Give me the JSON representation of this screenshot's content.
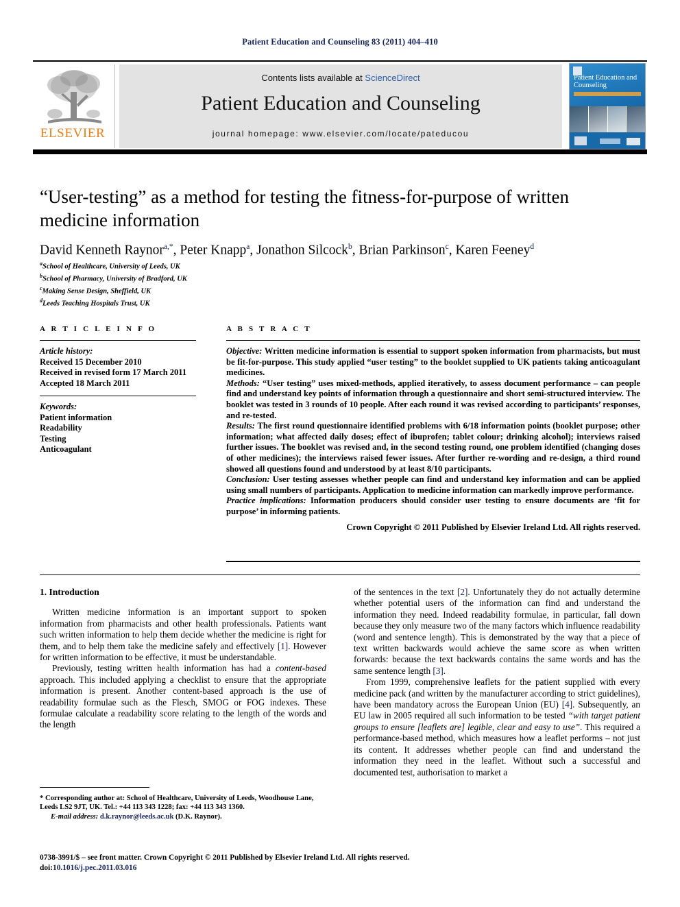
{
  "running_head": "Patient Education and Counseling 83 (2011) 404–410",
  "masthead": {
    "contents_prefix": "Contents lists available at ",
    "sciencedirect": "ScienceDirect",
    "journal_title": "Patient Education and Counseling",
    "homepage": "journal homepage: www.elsevier.com/locate/pateducou",
    "publisher_wordmark": "ELSEVIER",
    "cover_title": "Patient Education and Counseling",
    "accent_blue": "#2b5fa8",
    "accent_orange": "#f07f13",
    "link_navy": "#14215c"
  },
  "article": {
    "title": "“User-testing” as a method for testing the fitness-for-purpose of written medicine information",
    "authors": [
      {
        "name": "David Kenneth Raynor",
        "marks": "a,*"
      },
      {
        "name": "Peter Knapp",
        "marks": "a"
      },
      {
        "name": "Jonathon Silcock",
        "marks": "b"
      },
      {
        "name": "Brian Parkinson",
        "marks": "c"
      },
      {
        "name": "Karen Feeney",
        "marks": "d"
      }
    ],
    "affiliations": [
      {
        "mark": "a",
        "text": "School of Healthcare, University of Leeds, UK"
      },
      {
        "mark": "b",
        "text": "School of Pharmacy, University of Bradford, UK"
      },
      {
        "mark": "c",
        "text": "Making Sense Design, Sheffield, UK"
      },
      {
        "mark": "d",
        "text": "Leeds Teaching Hospitals Trust, UK"
      }
    ]
  },
  "article_info": {
    "heading": "A R T I C L E    I N F O",
    "history_label": "Article history:",
    "history": [
      "Received 15 December 2010",
      "Received in revised form 17 March 2011",
      "Accepted 18 March 2011"
    ],
    "keywords_label": "Keywords:",
    "keywords": [
      "Patient information",
      "Readability",
      "Testing",
      "Anticoagulant"
    ]
  },
  "abstract": {
    "heading": "A B S T R A C T",
    "sections": [
      {
        "label": "Objective:",
        "text": " Written medicine information is essential to support spoken information from pharmacists, but must be fit-for-purpose. This study applied “user testing” to the booklet supplied to UK patients taking anticoagulant medicines."
      },
      {
        "label": "Methods:",
        "text": " “User testing” uses mixed-methods, applied iteratively, to assess document performance – can people find and understand key points of information through a questionnaire and short semi-structured interview. The booklet was tested in 3 rounds of 10 people. After each round it was revised according to participants’ responses, and re-tested."
      },
      {
        "label": "Results:",
        "text": " The first round questionnaire identified problems with 6/18 information points (booklet purpose; other information; what affected daily doses; effect of ibuprofen; tablet colour; drinking alcohol); interviews raised further issues. The booklet was revised and, in the second testing round, one problem identified (changing doses of other medicines); the interviews raised fewer issues. After further re-wording and re-design, a third round showed all questions found and understood by at least 8/10 participants."
      },
      {
        "label": "Conclusion:",
        "text": " User testing assesses whether people can find and understand key information and can be applied using small numbers of participants. Application to medicine information can markedly improve performance."
      },
      {
        "label": "Practice implications:",
        "text": " Information producers should consider user testing to ensure documents are ‘fit for purpose’ in informing patients."
      }
    ],
    "copyright": "Crown Copyright © 2011 Published by Elsevier Ireland Ltd. All rights reserved."
  },
  "body": {
    "section_heading": "1. Introduction",
    "left_paragraphs": [
      {
        "parts": [
          {
            "t": "Written medicine information is an important support to spoken information from pharmacists and other health professionals. Patients want such written information to help them decide whether the medicine is right for them, and to help them take the medicine safely and effectively "
          },
          {
            "t": "[1]",
            "style": "cite"
          },
          {
            "t": ". However for written information to be effective, it must be understandable."
          }
        ]
      },
      {
        "parts": [
          {
            "t": "Previously, testing written health information has had a "
          },
          {
            "t": "content-based",
            "style": "ital"
          },
          {
            "t": " approach. This included applying a checklist to ensure that the appropriate information is present. Another content-based approach is the use of readability formulae such as the Flesch, SMOG or FOG indexes. These formulae calculate a readability score relating to the length of the words and the length"
          }
        ]
      }
    ],
    "right_paragraphs": [
      {
        "indent": false,
        "parts": [
          {
            "t": "of the sentences in the text "
          },
          {
            "t": "[2]",
            "style": "cite"
          },
          {
            "t": ". Unfortunately they do not actually determine whether potential users of the information can find and understand the information they need. Indeed readability formulae, in particular, fall down because they only measure two of the many factors which influence readability (word and sentence length). This is demonstrated by the way that a piece of text written backwards would achieve the same score as when written forwards: because the text backwards contains the same words and has the same sentence length "
          },
          {
            "t": "[3]",
            "style": "cite"
          },
          {
            "t": "."
          }
        ]
      },
      {
        "indent": true,
        "parts": [
          {
            "t": "From 1999, comprehensive leaflets for the patient supplied with every medicine pack (and written by the manufacturer according to strict guidelines), have been mandatory across the European Union (EU) "
          },
          {
            "t": "[4]",
            "style": "cite"
          },
          {
            "t": ". Subsequently, an EU law in 2005 required all such information to be tested "
          },
          {
            "t": "“with target patient groups to ensure [leaflets are] legible, clear and easy to use”",
            "style": "ital"
          },
          {
            "t": ". This required a performance-based method, which measures how a leaflet performs – not just its content. It addresses whether people can find and understand the information they need in the leaflet. Without such a successful and documented test, authorisation to market a"
          }
        ]
      }
    ]
  },
  "footnote": {
    "marker": "*",
    "corresponding": " Corresponding author at: School of Healthcare, University of Leeds, Woodhouse Lane, Leeds LS2 9JT, UK. Tel.: +44 113 343 1228; fax: +44 113 343 1360.",
    "email_label": "E-mail address:",
    "email": "d.k.raynor@leeds.ac.uk",
    "email_owner": " (D.K. Raynor)."
  },
  "imprint": {
    "front_matter": "0738-3991/$ – see front matter. Crown Copyright © 2011 Published by Elsevier Ireland Ltd. All rights reserved.",
    "doi_label": "doi:",
    "doi": "10.1016/j.pec.2011.03.016"
  }
}
